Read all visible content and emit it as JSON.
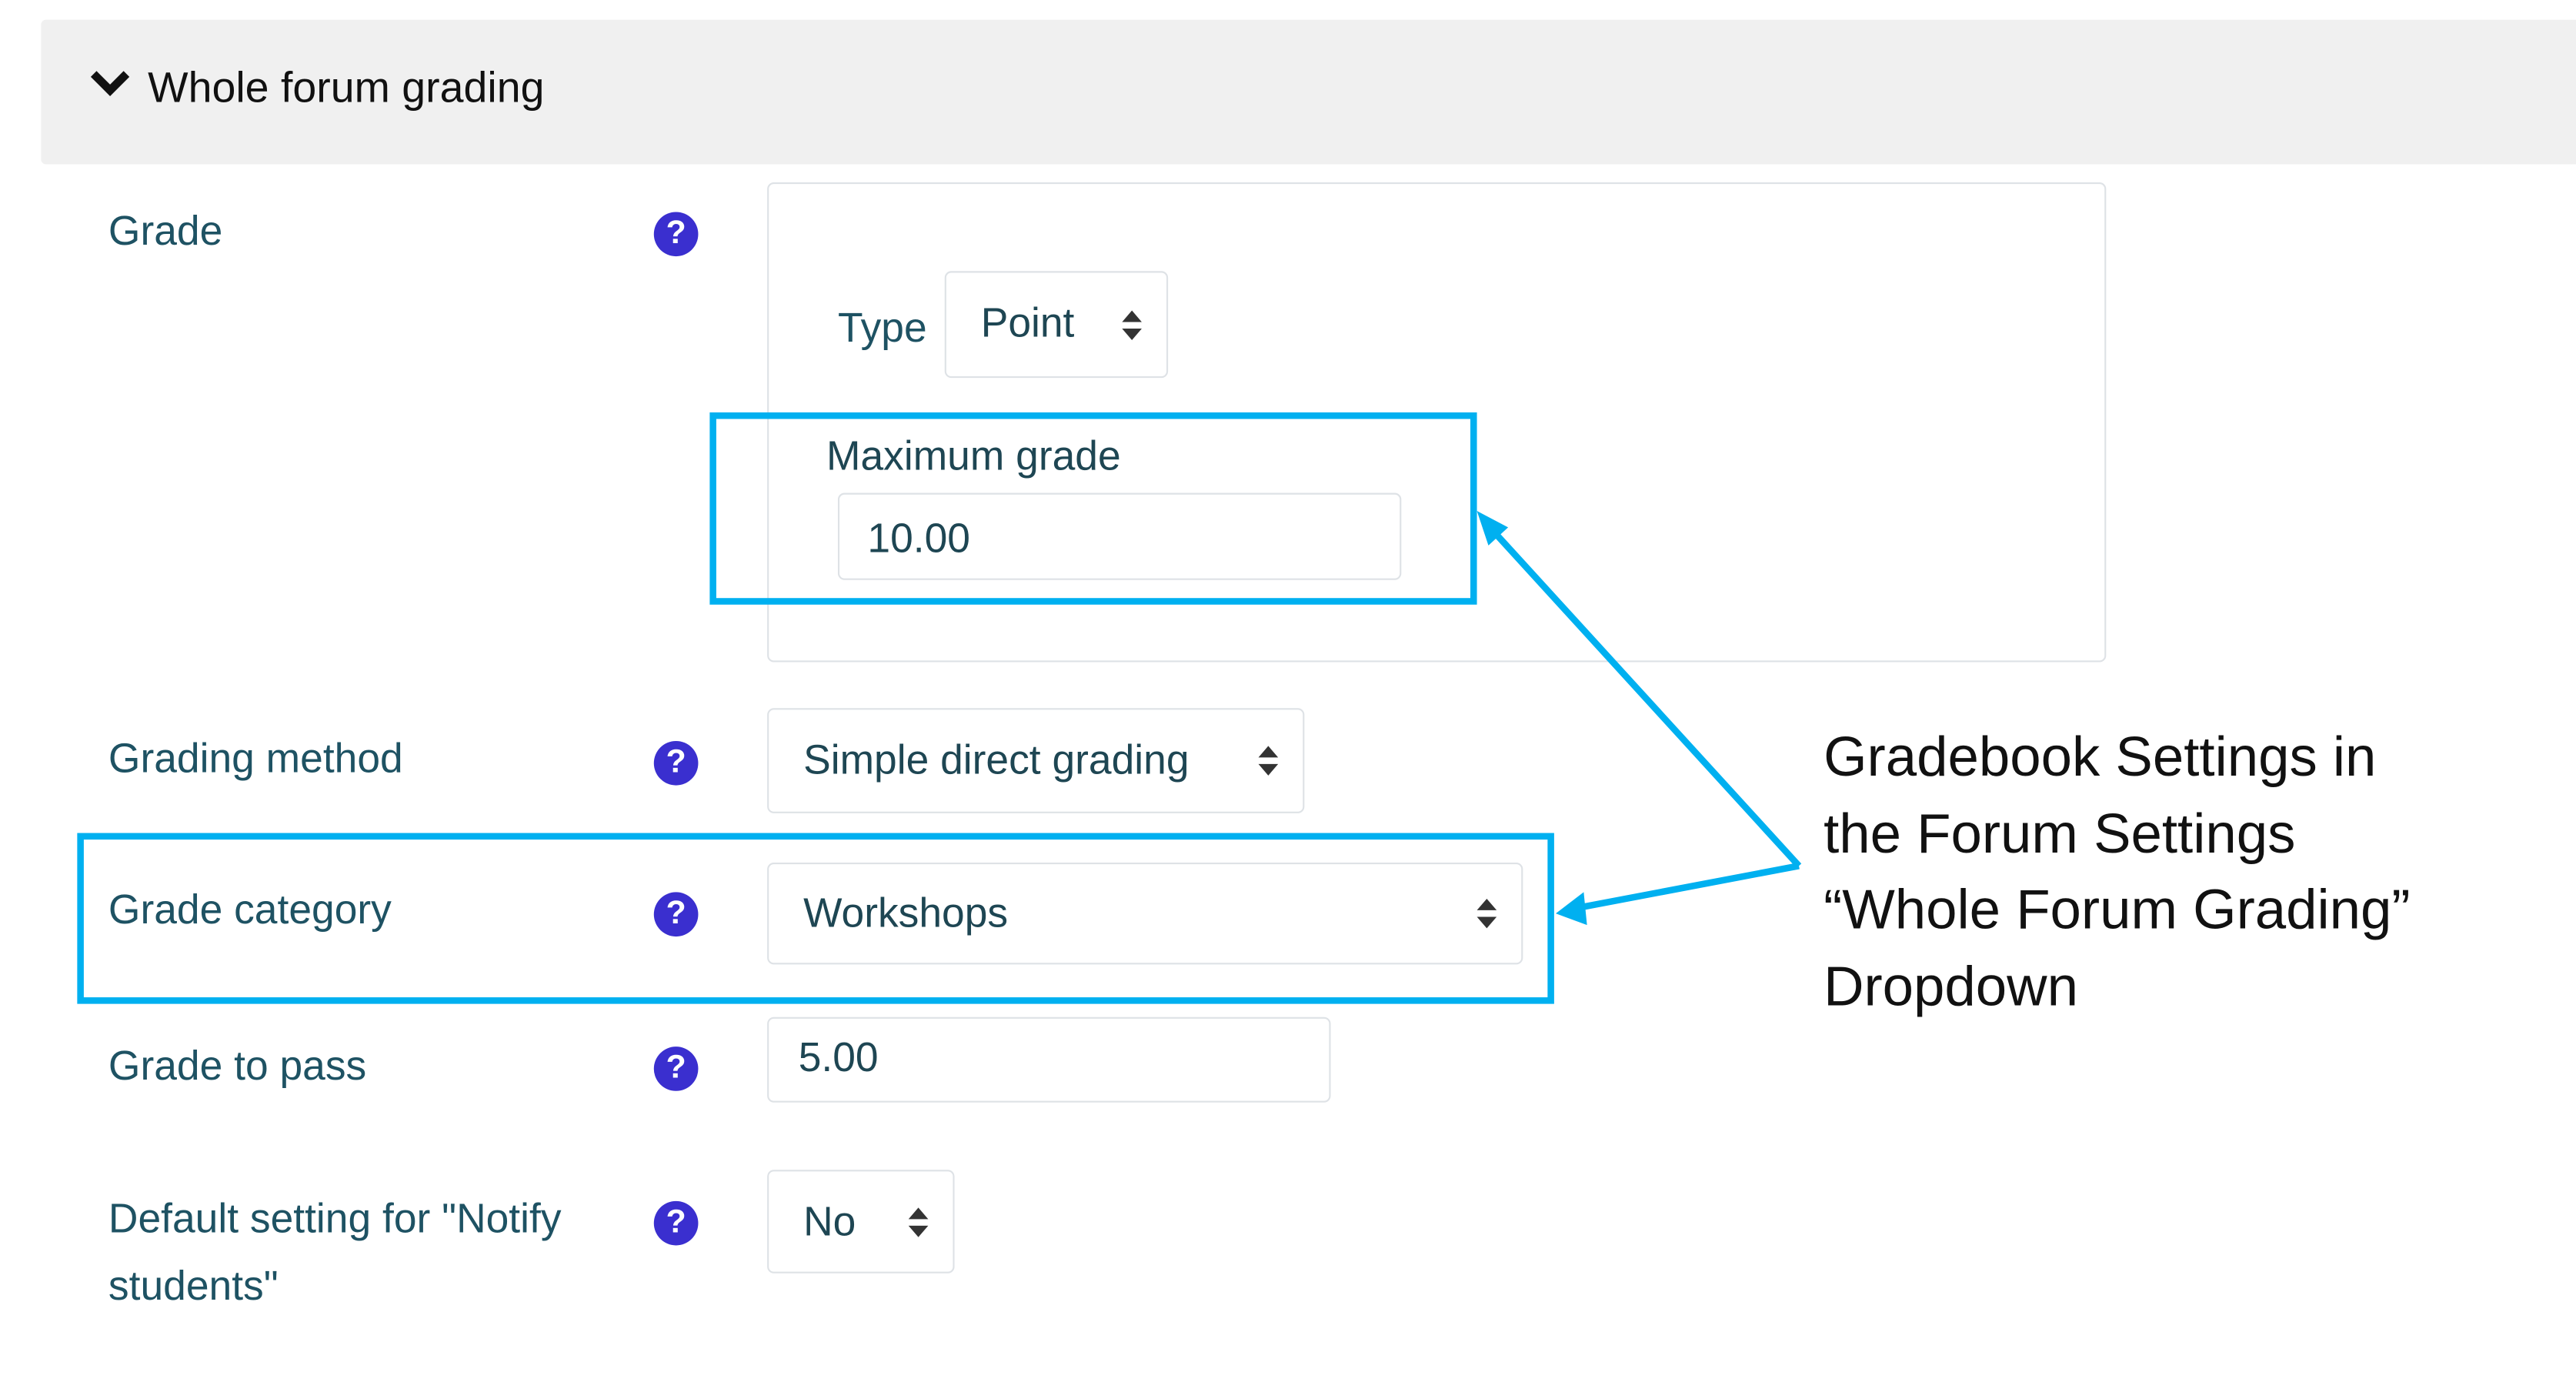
{
  "section": {
    "title": "Whole forum grading",
    "icon": "chevron-down-icon"
  },
  "fields": {
    "grade": {
      "label": "Grade",
      "type_label": "Type",
      "type_value": "Point",
      "max_label": "Maximum grade",
      "max_value": "10.00"
    },
    "grading_method": {
      "label": "Grading method",
      "value": "Simple direct grading"
    },
    "grade_category": {
      "label": "Grade category",
      "value": "Workshops"
    },
    "grade_to_pass": {
      "label": "Grade to pass",
      "value": "5.00"
    },
    "notify": {
      "label_line1": "Default setting for \"Notify",
      "label_line2": "students\"",
      "value": "No"
    }
  },
  "annotation": {
    "lines": [
      "Gradebook Settings in",
      "the Forum Settings",
      "“Whole Forum Grading”",
      "Dropdown"
    ]
  },
  "colors": {
    "highlight": "#00b0f0",
    "help_icon": "#3a2fcf",
    "label": "#1e5263",
    "header_bg": "#f0f0f0"
  }
}
